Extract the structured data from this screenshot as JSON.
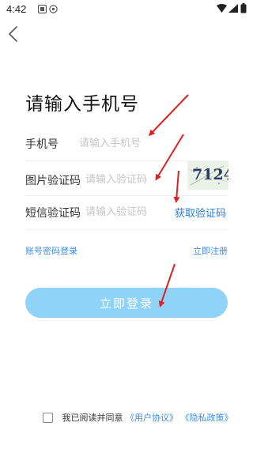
{
  "status_bar": {
    "time": "4:42"
  },
  "header": {
    "back_icon": "chevron-left-icon"
  },
  "title": "请输入手机号",
  "form": {
    "phone": {
      "label": "手机号",
      "placeholder": "请输入手机号"
    },
    "image_code": {
      "label": "图片验证码",
      "placeholder": "请输入验证码",
      "captcha_text": "7124"
    },
    "sms_code": {
      "label": "短信验证码",
      "placeholder": "请输入验证码",
      "get_code_label": "获取验证码"
    }
  },
  "links": {
    "password_login": "账号密码登录",
    "register": "立即注册"
  },
  "login_button": "立即登录",
  "agreement": {
    "prefix": "我已阅读并同意",
    "user_agreement": "《用户协议》",
    "privacy_policy": "《隐私政策》"
  },
  "colors": {
    "accent": "#2b7fd6",
    "button": "#8fd3f8",
    "annotation_arrows": "#e02020"
  }
}
